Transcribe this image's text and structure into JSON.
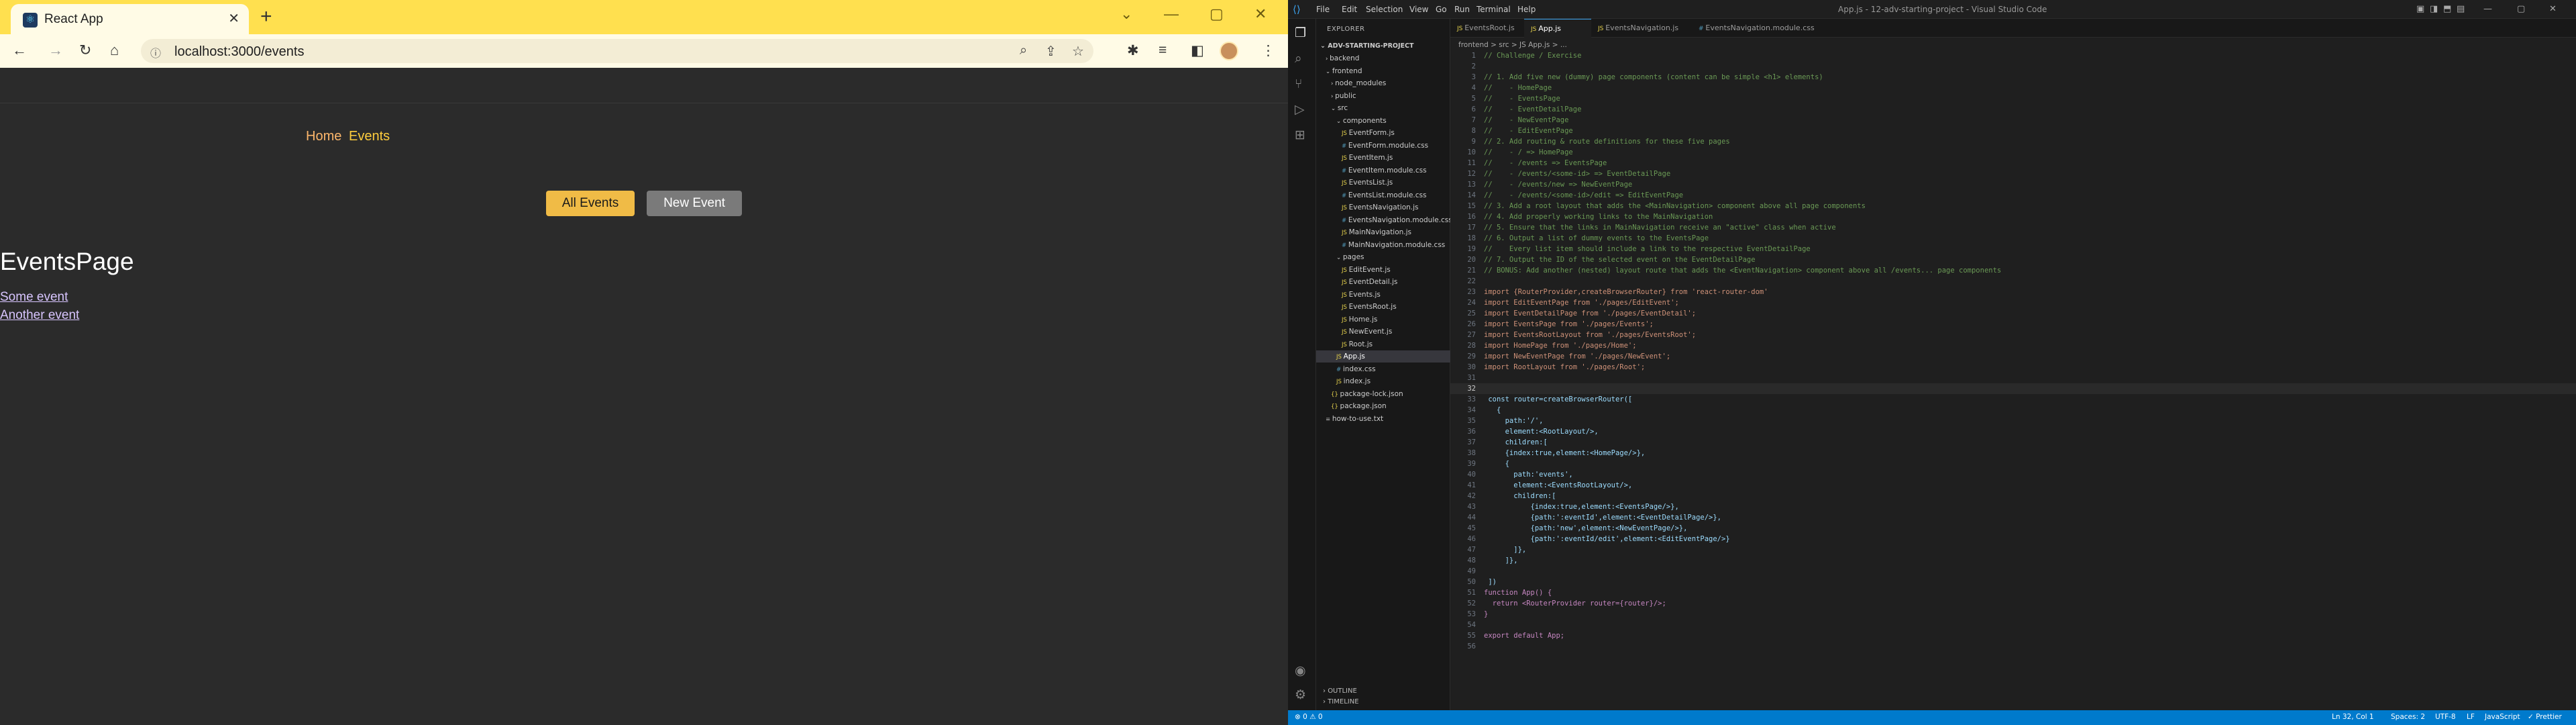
{
  "browser": {
    "tab_title": "React App",
    "tab_icon": "react-icon",
    "url": "localhost:3000/events",
    "accent_color": "#ffe04f",
    "page": {
      "nav": [
        "Home",
        "Events"
      ],
      "buttons": {
        "all_events": "All Events",
        "new_event": "New Event"
      },
      "heading": "EventsPage",
      "events": [
        "Some event",
        "Another event"
      ]
    }
  },
  "vscode": {
    "title": "App.js - 12-adv-starting-project - Visual Studio Code",
    "menu": [
      "File",
      "Edit",
      "Selection",
      "View",
      "Go",
      "Run",
      "Terminal",
      "Help"
    ],
    "explorer": {
      "title": "EXPLORER",
      "project": "ADV-STARTING-PROJECT",
      "tree": [
        {
          "label": "backend",
          "depth": 1,
          "kind": "folder-closed"
        },
        {
          "label": "frontend",
          "depth": 1,
          "kind": "folder-open"
        },
        {
          "label": "node_modules",
          "depth": 2,
          "kind": "folder-closed"
        },
        {
          "label": "public",
          "depth": 2,
          "kind": "folder-closed"
        },
        {
          "label": "src",
          "depth": 2,
          "kind": "folder-open"
        },
        {
          "label": "components",
          "depth": 3,
          "kind": "folder-open"
        },
        {
          "label": "EventForm.js",
          "depth": 4,
          "kind": "js"
        },
        {
          "label": "EventForm.module.css",
          "depth": 4,
          "kind": "css"
        },
        {
          "label": "EventItem.js",
          "depth": 4,
          "kind": "js"
        },
        {
          "label": "EventItem.module.css",
          "depth": 4,
          "kind": "css"
        },
        {
          "label": "EventsList.js",
          "depth": 4,
          "kind": "js"
        },
        {
          "label": "EventsList.module.css",
          "depth": 4,
          "kind": "css"
        },
        {
          "label": "EventsNavigation.js",
          "depth": 4,
          "kind": "js"
        },
        {
          "label": "EventsNavigation.module.css",
          "depth": 4,
          "kind": "css"
        },
        {
          "label": "MainNavigation.js",
          "depth": 4,
          "kind": "js"
        },
        {
          "label": "MainNavigation.module.css",
          "depth": 4,
          "kind": "css"
        },
        {
          "label": "pages",
          "depth": 3,
          "kind": "folder-open"
        },
        {
          "label": "EditEvent.js",
          "depth": 4,
          "kind": "js"
        },
        {
          "label": "EventDetail.js",
          "depth": 4,
          "kind": "js"
        },
        {
          "label": "Events.js",
          "depth": 4,
          "kind": "js"
        },
        {
          "label": "EventsRoot.js",
          "depth": 4,
          "kind": "js"
        },
        {
          "label": "Home.js",
          "depth": 4,
          "kind": "js"
        },
        {
          "label": "NewEvent.js",
          "depth": 4,
          "kind": "js"
        },
        {
          "label": "Root.js",
          "depth": 4,
          "kind": "js"
        },
        {
          "label": "App.js",
          "depth": 3,
          "kind": "js",
          "selected": true
        },
        {
          "label": "index.css",
          "depth": 3,
          "kind": "css"
        },
        {
          "label": "index.js",
          "depth": 3,
          "kind": "js"
        },
        {
          "label": "package-lock.json",
          "depth": 2,
          "kind": "json"
        },
        {
          "label": "package.json",
          "depth": 2,
          "kind": "json"
        },
        {
          "label": "how-to-use.txt",
          "depth": 1,
          "kind": "txt"
        }
      ],
      "outline": "OUTLINE",
      "timeline": "TIMELINE"
    },
    "tabs": [
      {
        "label": "EventsRoot.js",
        "active": false
      },
      {
        "label": "App.js",
        "active": true
      },
      {
        "label": "EventsNavigation.js",
        "active": false
      },
      {
        "label": "EventsNavigation.module.css",
        "active": false
      }
    ],
    "breadcrumbs": "frontend > src > JS App.js > ...",
    "code": [
      {
        "n": "1",
        "t": "// Challenge / Exercise",
        "c": "cmt"
      },
      {
        "n": "2",
        "t": "",
        "c": ""
      },
      {
        "n": "3",
        "t": "// 1. Add five new (dummy) page components (content can be simple <h1> elements)",
        "c": "cmt"
      },
      {
        "n": "4",
        "t": "//    - HomePage",
        "c": "cmt"
      },
      {
        "n": "5",
        "t": "//    - EventsPage",
        "c": "cmt"
      },
      {
        "n": "6",
        "t": "//    - EventDetailPage",
        "c": "cmt"
      },
      {
        "n": "7",
        "t": "//    - NewEventPage",
        "c": "cmt"
      },
      {
        "n": "8",
        "t": "//    - EditEventPage",
        "c": "cmt"
      },
      {
        "n": "9",
        "t": "// 2. Add routing & route definitions for these five pages",
        "c": "cmt"
      },
      {
        "n": "10",
        "t": "//    - / => HomePage",
        "c": "cmt"
      },
      {
        "n": "11",
        "t": "//    - /events => EventsPage",
        "c": "cmt"
      },
      {
        "n": "12",
        "t": "//    - /events/<some-id> => EventDetailPage",
        "c": "cmt"
      },
      {
        "n": "13",
        "t": "//    - /events/new => NewEventPage",
        "c": "cmt"
      },
      {
        "n": "14",
        "t": "//    - /events/<some-id>/edit => EditEventPage",
        "c": "cmt"
      },
      {
        "n": "15",
        "t": "// 3. Add a root layout that adds the <MainNavigation> component above all page components",
        "c": "cmt"
      },
      {
        "n": "16",
        "t": "// 4. Add properly working links to the MainNavigation",
        "c": "cmt"
      },
      {
        "n": "17",
        "t": "// 5. Ensure that the links in MainNavigation receive an \"active\" class when active",
        "c": "cmt"
      },
      {
        "n": "18",
        "t": "// 6. Output a list of dummy events to the EventsPage",
        "c": "cmt"
      },
      {
        "n": "19",
        "t": "//    Every list item should include a link to the respective EventDetailPage",
        "c": "cmt"
      },
      {
        "n": "20",
        "t": "// 7. Output the ID of the selected event on the EventDetailPage",
        "c": "cmt"
      },
      {
        "n": "21",
        "t": "// BONUS: Add another (nested) layout route that adds the <EventNavigation> component above all /events... page components",
        "c": "cmt"
      },
      {
        "n": "22",
        "t": "",
        "c": ""
      },
      {
        "n": "23",
        "t": "import {RouterProvider,createBrowserRouter} from 'react-router-dom'",
        "c": "imp"
      },
      {
        "n": "24",
        "t": "import EditEventPage from './pages/EditEvent';",
        "c": "imp"
      },
      {
        "n": "25",
        "t": "import EventDetailPage from './pages/EventDetail';",
        "c": "imp"
      },
      {
        "n": "26",
        "t": "import EventsPage from './pages/Events';",
        "c": "imp"
      },
      {
        "n": "27",
        "t": "import EventsRootLayout from './pages/EventsRoot';",
        "c": "imp"
      },
      {
        "n": "28",
        "t": "import HomePage from './pages/Home';",
        "c": "imp"
      },
      {
        "n": "29",
        "t": "import NewEventPage from './pages/NewEvent';",
        "c": "imp"
      },
      {
        "n": "30",
        "t": "import RootLayout from './pages/Root';",
        "c": "imp"
      },
      {
        "n": "31",
        "t": "",
        "c": ""
      },
      {
        "n": "32",
        "t": "",
        "c": "cur"
      },
      {
        "n": "33",
        "t": " const router=createBrowserRouter([",
        "c": "jsx"
      },
      {
        "n": "34",
        "t": "   {",
        "c": "jsx"
      },
      {
        "n": "35",
        "t": "     path:'/',",
        "c": "jsx"
      },
      {
        "n": "36",
        "t": "     element:<RootLayout/>,",
        "c": "jsx"
      },
      {
        "n": "37",
        "t": "     children:[",
        "c": "jsx"
      },
      {
        "n": "38",
        "t": "     {index:true,element:<HomePage/>},",
        "c": "jsx"
      },
      {
        "n": "39",
        "t": "     {",
        "c": "jsx"
      },
      {
        "n": "40",
        "t": "       path:'events',",
        "c": "jsx"
      },
      {
        "n": "41",
        "t": "       element:<EventsRootLayout/>,",
        "c": "jsx"
      },
      {
        "n": "42",
        "t": "       children:[",
        "c": "jsx"
      },
      {
        "n": "43",
        "t": "           {index:true,element:<EventsPage/>},",
        "c": "jsx"
      },
      {
        "n": "44",
        "t": "           {path:':eventId',element:<EventDetailPage/>},",
        "c": "jsx"
      },
      {
        "n": "45",
        "t": "           {path:'new',element:<NewEventPage/>},",
        "c": "jsx"
      },
      {
        "n": "46",
        "t": "           {path:':eventId/edit',element:<EditEventPage/>}",
        "c": "jsx"
      },
      {
        "n": "47",
        "t": "       ]},",
        "c": "jsx"
      },
      {
        "n": "48",
        "t": "     ]},",
        "c": "jsx"
      },
      {
        "n": "49",
        "t": "",
        "c": ""
      },
      {
        "n": "50",
        "t": " ])",
        "c": "jsx"
      },
      {
        "n": "51",
        "t": "function App() {",
        "c": "kw"
      },
      {
        "n": "52",
        "t": "  return <RouterProvider router={router}/>;",
        "c": "kw"
      },
      {
        "n": "53",
        "t": "}",
        "c": "kw"
      },
      {
        "n": "54",
        "t": "",
        "c": ""
      },
      {
        "n": "55",
        "t": "export default App;",
        "c": "kw"
      },
      {
        "n": "56",
        "t": "",
        "c": ""
      }
    ],
    "status": {
      "left": "⊗ 0 ⚠ 0",
      "position": "Ln 32, Col 1",
      "spaces": "Spaces: 2",
      "encoding": "UTF-8",
      "eol": "LF",
      "language": "JavaScript",
      "prettier": "✓ Prettier"
    },
    "accent_color": "#007acc"
  }
}
